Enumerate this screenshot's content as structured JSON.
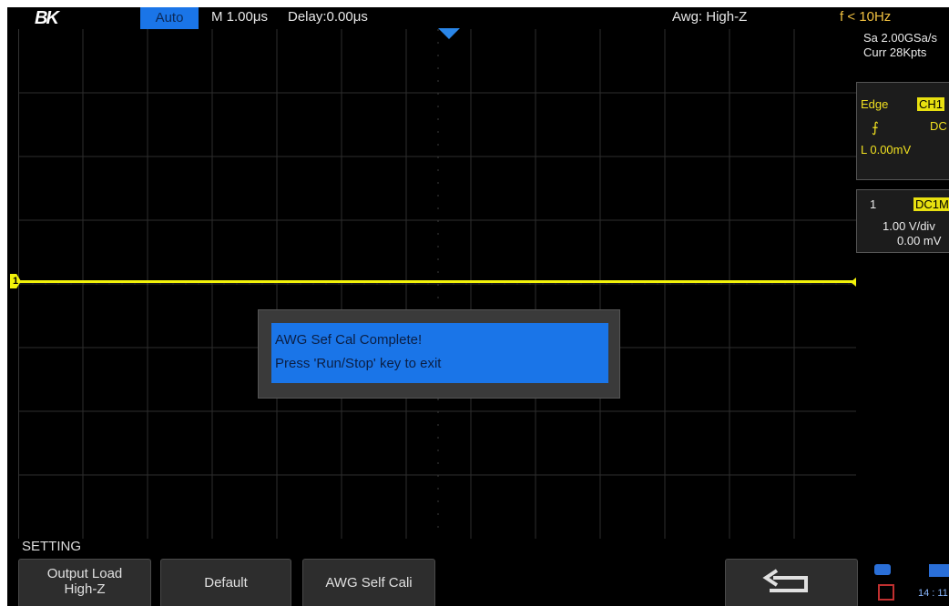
{
  "topbar": {
    "logo": "BK",
    "mode": "Auto",
    "timebase": "M 1.00μs",
    "delay": "Delay:0.00μs",
    "awg": "Awg: High-Z",
    "freq": "f < 10Hz"
  },
  "channel_marker": "1",
  "dialog": {
    "line1": "AWG Sef Cal Complete!",
    "line2": "Press 'Run/Stop' key to exit"
  },
  "right_panel": {
    "sa": "Sa 2.00GSa/s",
    "curr": "Curr 28Kpts",
    "trigger_type": "Edge",
    "trigger_source": "CH1",
    "coupling": "DC",
    "slope_icon": "rising-edge-icon",
    "level": "L  0.00mV",
    "ch_num": "1",
    "ch_coupling": "DC1M",
    "vdiv": "1.00 V/div",
    "offset": "0.00 mV"
  },
  "menu": {
    "title": "SETTING",
    "softkeys": [
      {
        "line1": "Output Load",
        "line2": "High-Z"
      },
      {
        "line1": "Default",
        "line2": ""
      },
      {
        "line1": "AWG Self Cali",
        "line2": ""
      }
    ],
    "back_icon": "return-arrow-icon"
  },
  "status": {
    "time": "14 : 11",
    "usb_icon": "usb-icon",
    "network_icon": "network-icon",
    "laptop_icon": "pc-connection-icon"
  },
  "colors": {
    "accent": "#1a75e8",
    "trace": "#f2f20a",
    "background": "#000000"
  }
}
